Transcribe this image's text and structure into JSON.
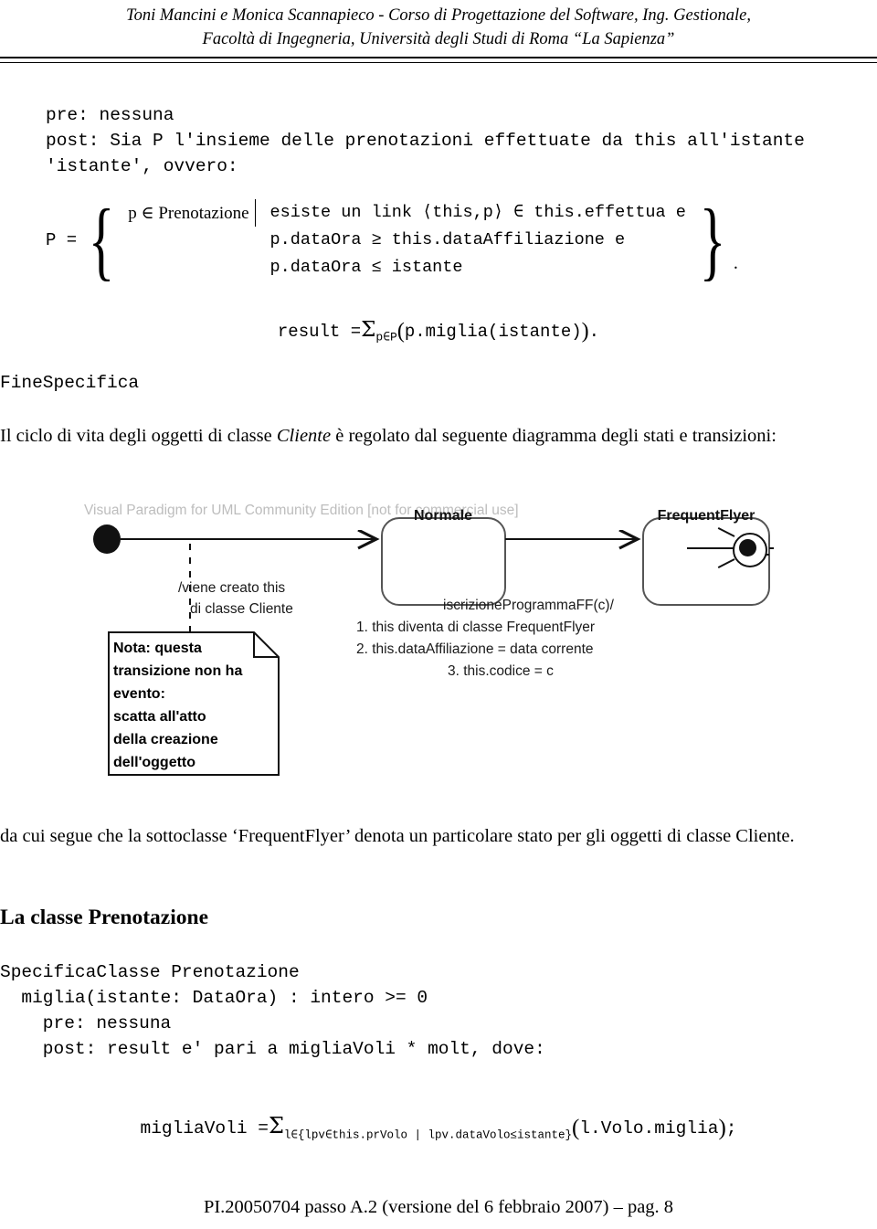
{
  "header": {
    "line1": "Toni Mancini e Monica Scannapieco - Corso di Progettazione del Software, Ing. Gestionale,",
    "line2": "Facoltà di Ingegneria, Università degli Studi di Roma “La Sapienza”"
  },
  "spec_top": {
    "lines": [
      "pre: nessuna",
      "post: Sia P l'insieme delle prenotazioni effettuate da this all'istante",
      "'istante', ovvero:"
    ]
  },
  "p_set": {
    "lhs": "P =",
    "left_condition": "p ∈ Prenotazione",
    "right_conditions": [
      "esiste un link ⟨this,p⟩ ∈ this.effettua e",
      "p.dataOra ≥ this.dataAffiliazione e",
      "p.dataOra ≤ istante"
    ],
    "trailing_period": "."
  },
  "result_formula": {
    "lhs": "result =",
    "sigma": "Σ",
    "subscript": "p∈P",
    "open_paren": "(",
    "body": "p.miglia(istante)",
    "close_paren": ")",
    "period": "."
  },
  "fine_specifica": "FineSpecifica",
  "para_ciclo": {
    "part1": "Il ciclo di vita degli oggetti di classe ",
    "emphasis": "Cliente",
    "part2": " è regolato dal seguente diagramma degli stati e transizioni:"
  },
  "diagram": {
    "watermark": "Visual Paradigm for UML Community Edition [not for commercial use]",
    "initial_state_name": "initial-state",
    "final_state_name": "final-state",
    "state_normale": "Normale",
    "state_frequentflyer": "FrequentFlyer",
    "transition_initial_label": [
      "/viene creato this",
      "di classe Cliente"
    ],
    "transition_ff_label": [
      "iscrizioneProgrammaFF(c)/",
      "1. this diventa di classe FrequentFlyer",
      "2. this.dataAffiliazione = data corrente",
      "3. this.codice = c"
    ],
    "note_lines": [
      "Nota: questa",
      "transizione non ha",
      "evento:",
      "scatta all'atto",
      "della creazione",
      "dell'oggetto"
    ]
  },
  "para_dacui": "da cui segue che la sottoclasse ‘FrequentFlyer’ denota un particolare stato per gli oggetti di classe Cliente.",
  "heading_classe": "La classe Prenotazione",
  "spec_bottom": {
    "lines": [
      "SpecificaClasse Prenotazione",
      "  miglia(istante: DataOra) : intero >= 0",
      "    pre: nessuna",
      "    post: result e' pari a migliaVoli * molt, dove:"
    ]
  },
  "formula_miglia": {
    "lhs": "migliaVoli =",
    "sigma": "Σ",
    "subscript": "l∈{lpv∈this.prVolo | lpv.dataVolo≤istante}",
    "open_paren": "(",
    "body": "l.Volo.miglia",
    "close_paren": ")",
    "semicolon": ";"
  },
  "footer": "PI.20050704 passo A.2 (versione del 6 febbraio 2007) – pag. 8"
}
